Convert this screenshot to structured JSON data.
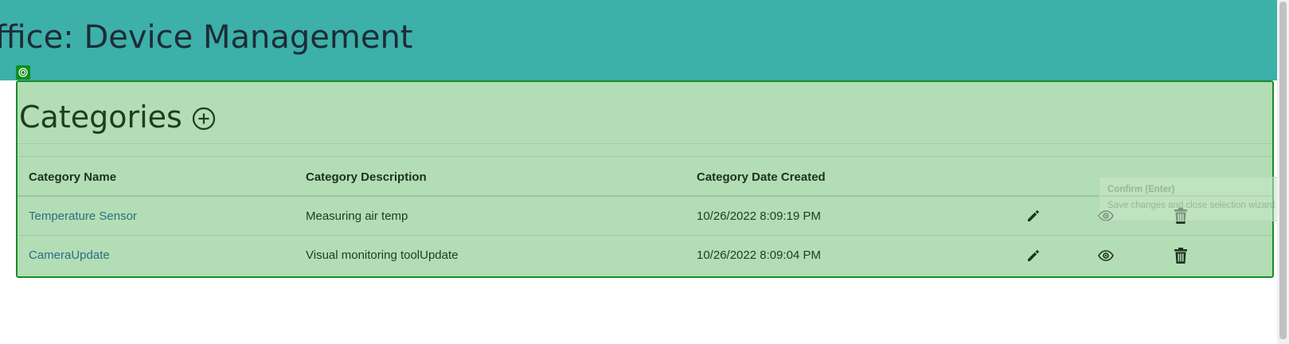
{
  "header": {
    "title": "ffice: Device Management"
  },
  "panel": {
    "heading": "Categories",
    "add_icon": "plus-circle-icon",
    "selection_icon": "target-icon"
  },
  "table": {
    "columns": [
      "Category Name",
      "Category Description",
      "Category Date Created"
    ],
    "rows": [
      {
        "name": "Temperature Sensor",
        "description": "Measuring air temp",
        "created": "10/26/2022 8:09:19 PM"
      },
      {
        "name": "CameraUpdate",
        "description": "Visual monitoring toolUpdate",
        "created": "10/26/2022 8:09:04 PM"
      }
    ],
    "action_icons": [
      "pencil-icon",
      "eye-icon",
      "trash-icon"
    ]
  },
  "tooltip": {
    "title": "Confirm (Enter)",
    "text": "Save changes and close selection wizard"
  },
  "colors": {
    "header_bg": "#3cb0a9",
    "panel_bg": "#b3ddb4",
    "panel_border": "#1a8a2a",
    "link": "#2a6f88"
  }
}
